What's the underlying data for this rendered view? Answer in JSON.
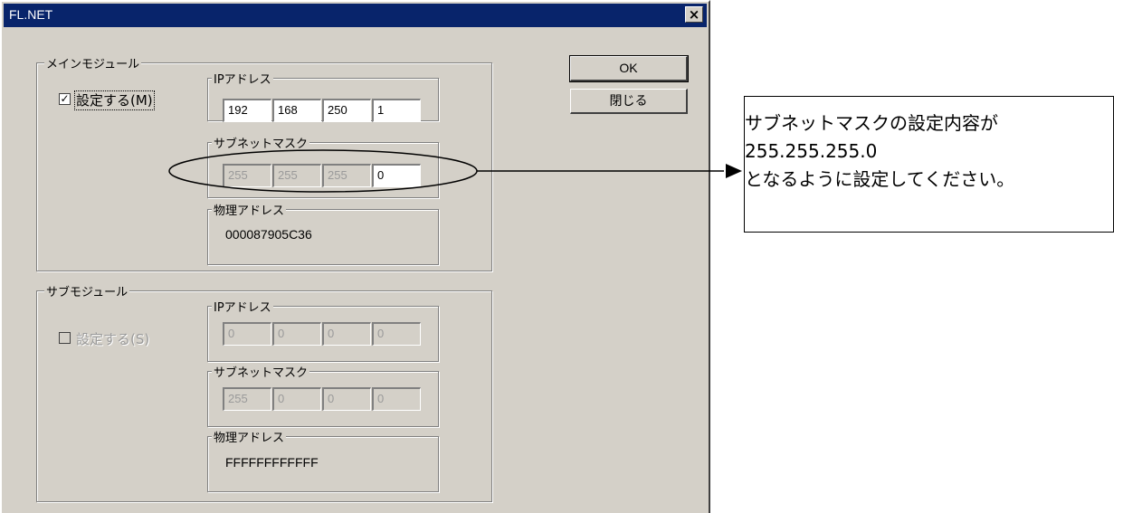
{
  "window": {
    "title": "FL.NET",
    "close_glyph": "×"
  },
  "buttons": {
    "ok": "OK",
    "close": "閉じる"
  },
  "main_module": {
    "label": "メインモジュール",
    "enable_checkbox": {
      "label": "設定する(M)",
      "checked": true,
      "check_glyph": "✓"
    },
    "ip_address": {
      "label": "IPアドレス",
      "octets": [
        "192",
        "168",
        "250",
        "1"
      ]
    },
    "subnet_mask": {
      "label": "サブネットマスク",
      "octets": [
        "255",
        "255",
        "255",
        "0"
      ]
    },
    "physical_address": {
      "label": "物理アドレス",
      "value": "000087905C36"
    }
  },
  "sub_module": {
    "label": "サブモジュール",
    "enable_checkbox": {
      "label": "設定する(S)",
      "checked": false
    },
    "ip_address": {
      "label": "IPアドレス",
      "octets": [
        "0",
        "0",
        "0",
        "0"
      ]
    },
    "subnet_mask": {
      "label": "サブネットマスク",
      "octets": [
        "255",
        "0",
        "0",
        "0"
      ]
    },
    "physical_address": {
      "label": "物理アドレス",
      "value": "FFFFFFFFFFFF"
    }
  },
  "annotation": {
    "lines": [
      "サブネットマスクの設定内容が",
      "255.255.255.0",
      "となるように設定してください。"
    ]
  },
  "colors": {
    "titlebar": "#08246b",
    "dialog_face": "#d4d0c8",
    "disabled_text": "#9a9a9a"
  }
}
